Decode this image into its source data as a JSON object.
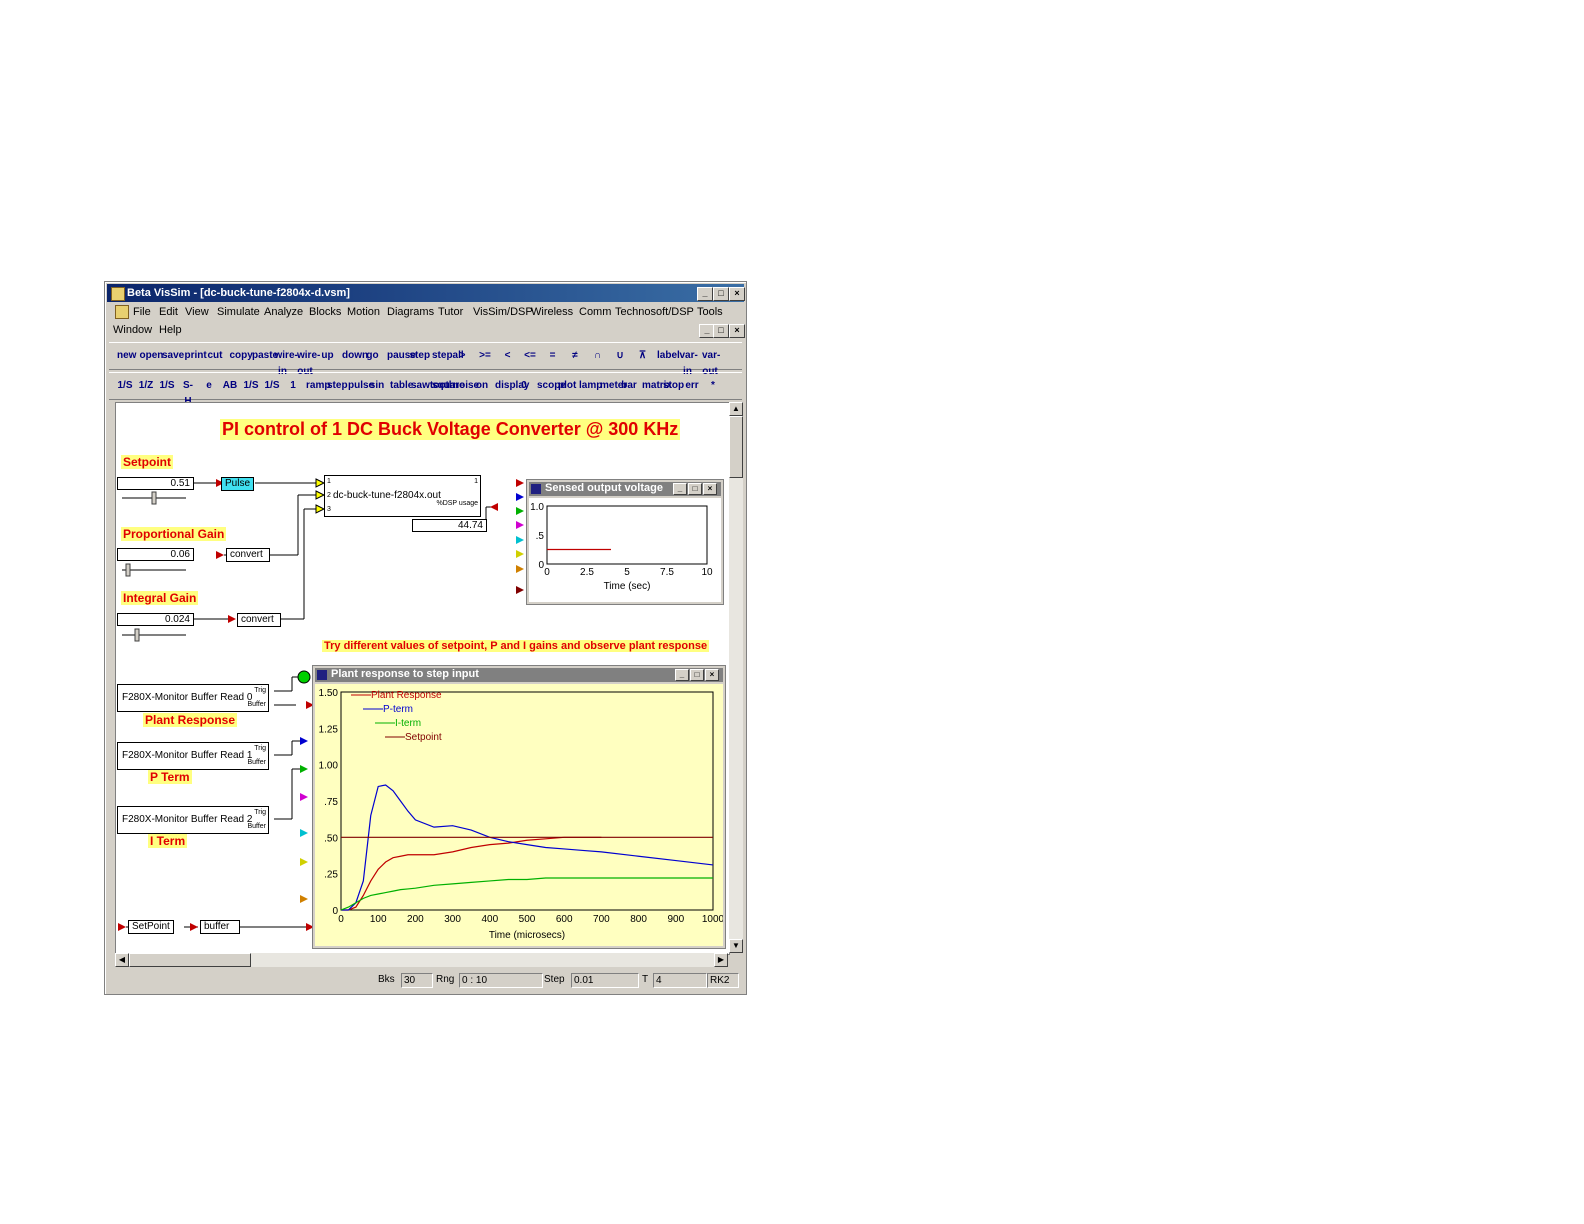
{
  "window": {
    "title": "Beta VisSim - [dc-buck-tune-f2804x-d.vsm]",
    "min": "_",
    "max": "□",
    "close": "×"
  },
  "menu": {
    "row1": [
      "File",
      "Edit",
      "View",
      "Simulate",
      "Analyze",
      "Blocks",
      "Motion",
      "Diagrams",
      "Tutor",
      "VisSim/DSP",
      "Wireless",
      "Comm",
      "Technosoft/DSP",
      "Tools"
    ],
    "row2": [
      "Window",
      "Help"
    ]
  },
  "toolbar1": [
    "new",
    "open",
    "save",
    "print",
    "cut",
    "copy",
    "paste",
    "wire-in",
    "wire-out",
    "up",
    "down",
    "go",
    "pause",
    "step",
    "stepall",
    ">",
    ">=",
    "<",
    "<=",
    "=",
    "≠",
    "∩",
    "∪",
    "⊼",
    "label",
    "var-in",
    "var-out"
  ],
  "toolbar2": [
    "1/S",
    "1/Z",
    "1/S",
    "S-H",
    "e",
    "AB",
    "1/S",
    "1/S",
    "1",
    "ramp",
    "step",
    "pulse",
    "sin",
    "table",
    "sawtooth",
    "square",
    "noise",
    "on",
    "display",
    "0",
    "scope",
    "plot",
    "lamp",
    "meter",
    "bar",
    "matrix",
    "stop",
    "err",
    "*"
  ],
  "diagram": {
    "title": "PI control of 1 DC Buck Voltage Converter @ 300 KHz",
    "setpoint_label": "Setpoint",
    "setpoint_value": "0.51",
    "pulse_label": "Pulse",
    "pgain_label": "Proportional Gain",
    "pgain_value": "0.06",
    "igain_label": "Integral Gain",
    "igain_value": "0.024",
    "convert_label": "convert",
    "main_block": "dc-buck-tune-f2804x.out",
    "main_block_sub": "%DSP usage",
    "usage_value": "44.74",
    "hint": "Try different values of setpoint, P and I gains and observe plant response",
    "monitors": [
      {
        "name": "F280X-Monitor Buffer Read 0",
        "caption": "Plant Response"
      },
      {
        "name": "F280X-Monitor Buffer Read 1",
        "caption": "P Term"
      },
      {
        "name": "F280X-Monitor Buffer Read 2",
        "caption": "I Term"
      }
    ],
    "trig": "Trig",
    "buffer_port": "Buffer",
    "setpoint_block": "SetPoint",
    "buffer_block": "buffer"
  },
  "sensed_plot": {
    "title": "Sensed output voltage",
    "xlabel": "Time (sec)",
    "yticks": [
      "1.0",
      ".5",
      "0"
    ],
    "xticks": [
      "0",
      "2.5",
      "5",
      "7.5",
      "10"
    ]
  },
  "plant_plot": {
    "title": "Plant response to step input",
    "xlabel": "Time (microsecs)",
    "yticks": [
      "1.50",
      "1.25",
      "1.00",
      ".75",
      ".50",
      ".25",
      "0"
    ],
    "xticks": [
      "0",
      "100",
      "200",
      "300",
      "400",
      "500",
      "600",
      "700",
      "800",
      "900",
      "1000"
    ],
    "legend": [
      "Plant Response",
      "P-term",
      "I-term",
      "Setpoint"
    ]
  },
  "chart_data": [
    {
      "type": "line",
      "title": "Sensed output voltage",
      "xlabel": "Time (sec)",
      "xlim": [
        0,
        10
      ],
      "ylim": [
        0,
        1.0
      ],
      "series": [
        {
          "x": [
            0,
            1.5,
            3.0,
            4.0
          ],
          "values": [
            0.25,
            0.25,
            0.25,
            0.25
          ],
          "color": "#c00000"
        }
      ]
    },
    {
      "type": "line",
      "title": "Plant response to step input",
      "xlabel": "Time (microsecs)",
      "xlim": [
        0,
        1000
      ],
      "ylim": [
        0,
        1.5
      ],
      "x": [
        0,
        20,
        40,
        60,
        80,
        100,
        120,
        140,
        160,
        180,
        200,
        250,
        300,
        350,
        400,
        450,
        500,
        550,
        600,
        650,
        700,
        800,
        900,
        1000
      ],
      "series": [
        {
          "name": "Plant Response",
          "color": "#c00000",
          "values": [
            0,
            0,
            0.02,
            0.1,
            0.2,
            0.28,
            0.33,
            0.36,
            0.37,
            0.38,
            0.38,
            0.38,
            0.4,
            0.43,
            0.45,
            0.46,
            0.48,
            0.49,
            0.5,
            0.5,
            0.5,
            null,
            null,
            null
          ]
        },
        {
          "name": "P-term",
          "color": "#0000d0",
          "values": [
            0,
            0,
            0.05,
            0.2,
            0.65,
            0.85,
            0.86,
            0.82,
            0.75,
            0.68,
            0.62,
            0.57,
            0.58,
            0.55,
            0.5,
            0.47,
            0.45,
            0.43,
            0.42,
            0.41,
            0.4,
            0.37,
            0.34,
            0.31
          ]
        },
        {
          "name": "I-term",
          "color": "#00b000",
          "values": [
            0,
            0.02,
            0.05,
            0.08,
            0.1,
            0.11,
            0.12,
            0.13,
            0.14,
            0.145,
            0.15,
            0.17,
            0.18,
            0.19,
            0.2,
            0.21,
            0.21,
            0.22,
            0.22,
            0.22,
            0.22,
            0.22,
            0.22,
            0.22
          ]
        },
        {
          "name": "Setpoint",
          "color": "#800000",
          "values": [
            0.5,
            0.5,
            0.5,
            0.5,
            0.5,
            0.5,
            0.5,
            0.5,
            0.5,
            0.5,
            0.5,
            0.5,
            0.5,
            0.5,
            0.5,
            0.5,
            0.5,
            0.5,
            0.5,
            0.5,
            0.5,
            0.5,
            0.5,
            0.5
          ]
        }
      ]
    }
  ],
  "status": {
    "bks_label": "Bks",
    "bks": "30",
    "rng_label": "Rng",
    "rng": "0 : 10",
    "step_label": "Step",
    "step": "0.01",
    "t_label": "T",
    "t": "4",
    "method": "RK2"
  }
}
